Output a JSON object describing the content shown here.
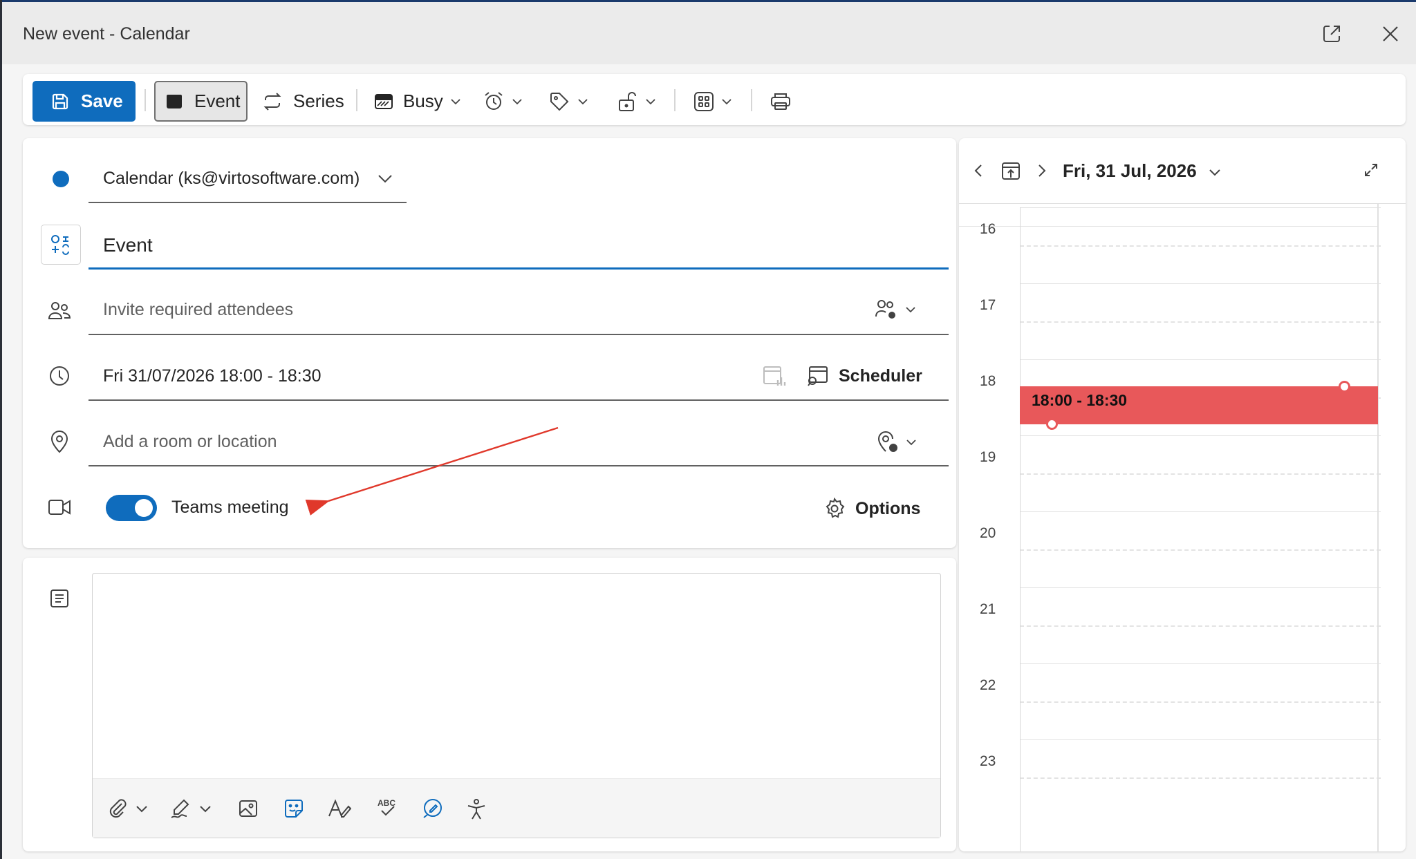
{
  "window": {
    "title": "New event - Calendar"
  },
  "toolbar": {
    "save_label": "Save",
    "event_label": "Event",
    "series_label": "Series",
    "busy_label": "Busy"
  },
  "form": {
    "calendar_label": "Calendar (ks@virtosoftware.com)",
    "title_value": "Event",
    "attendees_placeholder": "Invite required attendees",
    "datetime_value": "Fri 31/07/2026 18:00 - 18:30",
    "scheduler_label": "Scheduler",
    "location_placeholder": "Add a room or location",
    "teams_label": "Teams meeting",
    "teams_enabled": true,
    "options_label": "Options"
  },
  "calendar": {
    "date_label": "Fri, 31 Jul, 2026",
    "hours": [
      "16",
      "17",
      "18",
      "19",
      "20",
      "21",
      "22",
      "23"
    ],
    "event_time": "18:00 - 18:30",
    "event_color": "#e8585a"
  },
  "colors": {
    "accent": "#0f6cbd",
    "annotation_arrow": "#e0382b"
  }
}
